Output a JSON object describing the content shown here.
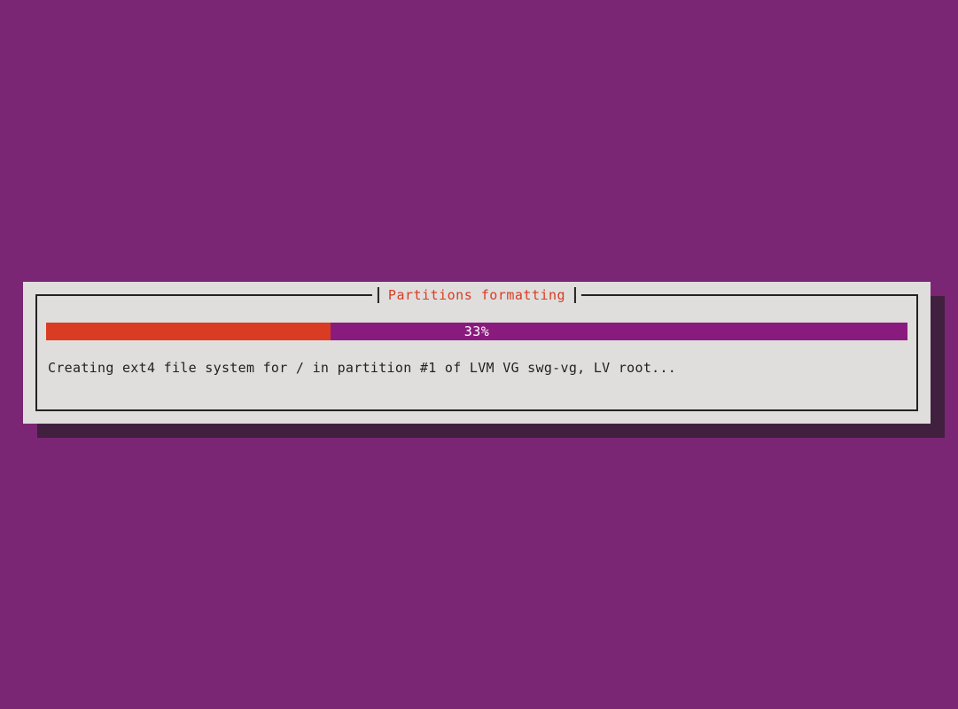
{
  "dialog": {
    "title": "Partitions formatting",
    "progress": {
      "percent": 33,
      "label": "33%"
    },
    "status": "Creating ext4 file system for / in partition #1 of LVM VG swg-vg, LV root..."
  },
  "colors": {
    "background": "#7a2674",
    "dialogBg": "#e0dedd",
    "accentRed": "#d93c22",
    "progressTrack": "#8a1b7e",
    "text": "#222"
  }
}
